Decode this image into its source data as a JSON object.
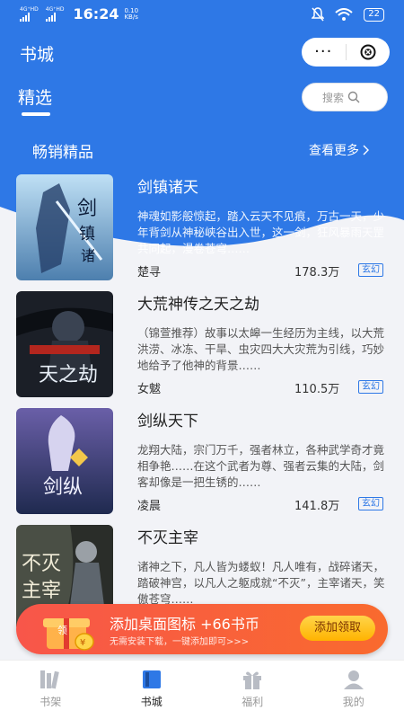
{
  "status_bar": {
    "signal1": "4G⁺HD",
    "signal2": "4G⁺HD",
    "time": "16:24",
    "speed_value": "0.10",
    "speed_unit": "KB/s",
    "battery": "22"
  },
  "header": {
    "title": "书城",
    "more_label": "···"
  },
  "tabs": {
    "active": "精选"
  },
  "search": {
    "placeholder": "搜索"
  },
  "section": {
    "title": "畅销精品",
    "see_more": "查看更多"
  },
  "books": [
    {
      "title": "剑镇诸天",
      "desc": "神魂如影般惊起，踏入云天不见痕，万古一天，少年背剑从神秘峡谷出入世，这一剑，狂风暴雨天罡共同起，漫卷苍穹……",
      "author": "楚寻",
      "count": "178.3万",
      "tag": "玄幻"
    },
    {
      "title": "大荒神传之天之劫",
      "desc": "（锦萱推荐）故事以太皞一生经历为主线，以大荒洪涝、冰冻、干旱、虫灾四大大灾荒为引线，巧妙地给予了他神的背景……",
      "author": "女魃",
      "count": "110.5万",
      "tag": "玄幻"
    },
    {
      "title": "剑纵天下",
      "desc": "龙翔大陆，宗门万千，强者林立，各种武学奇才竟相争艳……在这个武者为尊、强者云集的大陆，剑客却像是一把生锈的……",
      "author": "凌晨",
      "count": "141.8万",
      "tag": "玄幻"
    },
    {
      "title": "不灭主宰",
      "desc": "诸神之下，凡人皆为蝼蚁！凡人唯有，战碎诸天，踏破神宫，以凡人之躯成就“不灭”，主宰诸天，笑傲苍穹……",
      "author": "",
      "count": "",
      "tag": ""
    }
  ],
  "promo": {
    "title": "添加桌面图标 +66书币",
    "subtitle": "无需安装下载，一键添加即可>>>",
    "button": "添加领取",
    "gift_label": "领"
  },
  "bottom_nav": {
    "items": [
      {
        "label": "书架",
        "icon": "bookshelf-icon"
      },
      {
        "label": "书城",
        "icon": "bookstore-icon"
      },
      {
        "label": "福利",
        "icon": "gift-icon"
      },
      {
        "label": "我的",
        "icon": "profile-icon"
      }
    ]
  },
  "colors": {
    "primary": "#2e78e6",
    "promo": "#f8564a",
    "promo_button": "#ffc107"
  }
}
